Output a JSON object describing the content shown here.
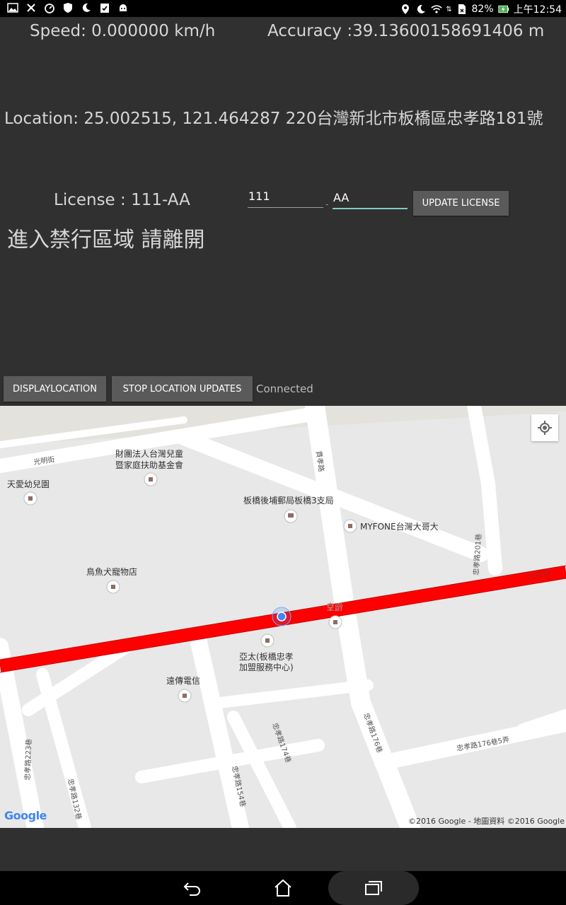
{
  "statusbar": {
    "battery": "82%",
    "time": "上午12:54"
  },
  "app": {
    "speed": "Speed: 0.000000 km/h",
    "accuracy": "Accuracy :39.13600158691406 m",
    "location": "Location: 25.002515, 121.464287  220台灣新北市板橋區忠孝路181號",
    "license": "License : 111-AA",
    "license_part1": "111",
    "license_sep": "-",
    "license_part2": "AA",
    "update_license_button": "UPDATE LICENSE",
    "warning": "進入禁行區域 請離開",
    "display_location_button": "DISPLAYLOCATION",
    "stop_updates_button": "STOP LOCATION UPDATES",
    "connection_status": "Connected"
  },
  "map": {
    "streets": {
      "guangming": "光明街",
      "guanlian": "貫孝路",
      "zhongxiao201": "忠孝路201巷",
      "zhongxiao_road": "忠孝路",
      "zhongxiao176": "忠孝路176巷",
      "zhongxiao174": "忠孝路174巷",
      "zhongxiao154": "忠孝路154巷",
      "zhongxiao132": "忠孝路132巷",
      "zhongxiao223": "忠孝路223巷",
      "zhongxiao176_5": "忠孝路176巷5弄"
    },
    "pois": {
      "foundation_line1": "財團法人台灣兒童",
      "foundation_line2": "暨家庭扶助基金會",
      "kindergarten": "天愛幼兒園",
      "post_office": "板橋後埔郵局板橋3支局",
      "myfone": "MYFONE台灣大哥大",
      "pet_store": "鳥魚犬寵物店",
      "huangjue": "皇爵",
      "asia_pacific_line1": "亞太(板橋忠孝",
      "asia_pacific_line2": "加盟服務中心)",
      "fareastone": "遠傳電信"
    },
    "google_logo": "Google",
    "copyright": "©2016 Google - 地圖資料 ©2016 Google"
  }
}
